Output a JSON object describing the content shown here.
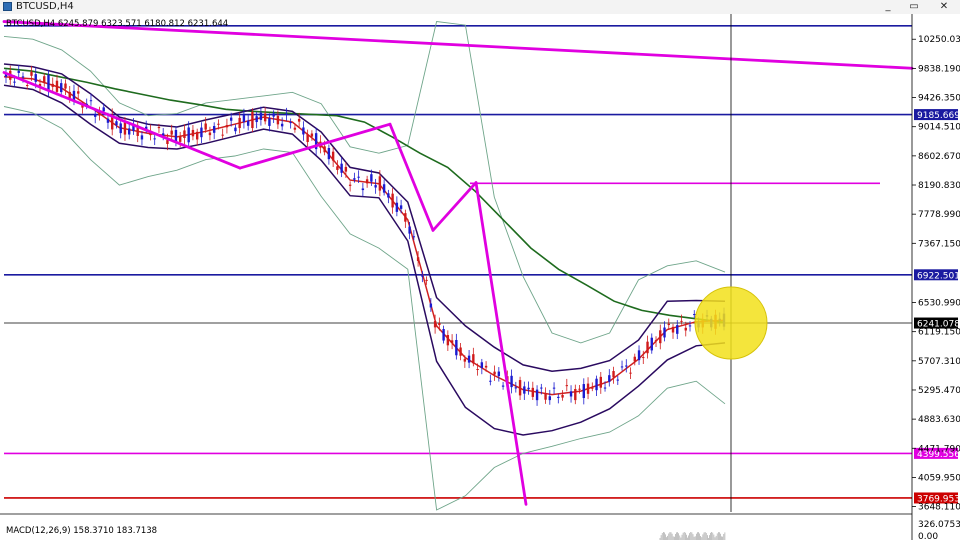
{
  "window": {
    "title": "BTCUSD,H4",
    "minimize_label": "_",
    "restore_label": "▭",
    "close_label": "✕"
  },
  "chart_data": {
    "type": "line",
    "symbol": "BTCUSD",
    "timeframe": "H4",
    "header_info": "BTCUSD,H4  6245.879 6323.571 6180.812 6231.644",
    "price_axis": {
      "ticks": [
        "10250.030",
        "9838.190",
        "9426.350",
        "9014.510",
        "8602.670",
        "8190.830",
        "7778.990",
        "7367.150",
        "6530.990",
        "6119.150",
        "5707.310",
        "5295.470",
        "4883.630",
        "4471.790",
        "4059.950",
        "3648.110"
      ],
      "ylim": [
        3600,
        10550
      ]
    },
    "horizontal_levels": [
      {
        "price": 10440,
        "color": "#1a1aa0",
        "label": ""
      },
      {
        "price": 9185.669,
        "color": "#1a1aa0",
        "label": "9185.669"
      },
      {
        "price": 8215,
        "color": "#e000e0",
        "label": ""
      },
      {
        "price": 6922.501,
        "color": "#1a1aa0",
        "label": "6922.501"
      },
      {
        "price": 6241.078,
        "color": "#000000",
        "label": "6241.078"
      },
      {
        "price": 4399.556,
        "color": "#e000e0",
        "label": "4399.556"
      },
      {
        "price": 3769.953,
        "color": "#cc0000",
        "label": "3769.953"
      }
    ],
    "series": [
      {
        "name": "",
        "color": "#1e6b1e",
        "values": [
          9840,
          9800,
          9720,
          9640,
          9550,
          9470,
          9390,
          9330,
          9260,
          9230,
          9210,
          9190,
          9170,
          9080,
          8870,
          8640,
          8440,
          8100,
          7700,
          7300,
          7000,
          6780,
          6550,
          6420,
          6350,
          6300,
          6250
        ]
      },
      {
        "name": "",
        "color": "#d02020",
        "values": [
          9720,
          9690,
          9560,
          9290,
          9000,
          8920,
          8870,
          8950,
          9050,
          9150,
          9080,
          8750,
          8260,
          8210,
          7700,
          6200,
          5750,
          5500,
          5300,
          5230,
          5280,
          5420,
          5730,
          6150,
          6260,
          6280
        ]
      },
      {
        "name": "",
        "color": "#2a0a60",
        "values": [
          9900,
          9860,
          9760,
          9480,
          9150,
          9050,
          9010,
          9110,
          9200,
          9290,
          9230,
          8940,
          8440,
          8360,
          7950,
          6600,
          6200,
          5900,
          5650,
          5560,
          5600,
          5710,
          6000,
          6550,
          6560,
          6550
        ]
      },
      {
        "name": "",
        "color": "#2a0a60",
        "values": [
          9600,
          9540,
          9350,
          9050,
          8780,
          8720,
          8700,
          8780,
          8880,
          8980,
          8910,
          8540,
          8040,
          8010,
          7400,
          5700,
          5050,
          4750,
          4660,
          4720,
          4840,
          5030,
          5350,
          5720,
          5920,
          5960
        ]
      }
    ],
    "bollinger_upper": [
      10290,
      10250,
      10100,
      9800,
      9350,
      9170,
      9200,
      9350,
      9400,
      9450,
      9500,
      9340,
      8730,
      8640,
      8750,
      10500,
      10450,
      8020,
      6900,
      6100,
      5960,
      6100,
      6850,
      7050,
      7120,
      6960
    ],
    "bollinger_lower": [
      9300,
      9210,
      8990,
      8550,
      8190,
      8310,
      8400,
      8550,
      8600,
      8700,
      8650,
      8030,
      7500,
      7300,
      7000,
      3600,
      3800,
      4200,
      4400,
      4500,
      4610,
      4700,
      4930,
      5320,
      5420,
      5100
    ],
    "trendlines": [
      {
        "color": "#e000e0",
        "points": [
          [
            0,
            10500
          ],
          [
            1,
            10050
          ]
        ]
      },
      {
        "color": "#e000e0",
        "points": [
          [
            2,
            9780
          ],
          [
            3,
            8430
          ]
        ]
      },
      {
        "color": "#e000e0",
        "points": [
          [
            4,
            8430
          ],
          [
            5,
            9050
          ]
        ]
      },
      {
        "color": "#e000e0",
        "points": [
          [
            6,
            9050
          ],
          [
            7,
            7550
          ]
        ]
      },
      {
        "color": "#e000e0",
        "points": [
          [
            8,
            7550
          ],
          [
            9,
            8225
          ]
        ]
      },
      {
        "color": "#e000e0",
        "points": [
          [
            10,
            8225
          ],
          [
            11,
            3680
          ]
        ]
      }
    ],
    "highlight_circle_price": 6241.078,
    "indicator": {
      "label": "MACD(12,26,9) 158.3710 183.7138",
      "axis_ticks": [
        "326.0753",
        "0.00"
      ]
    }
  }
}
